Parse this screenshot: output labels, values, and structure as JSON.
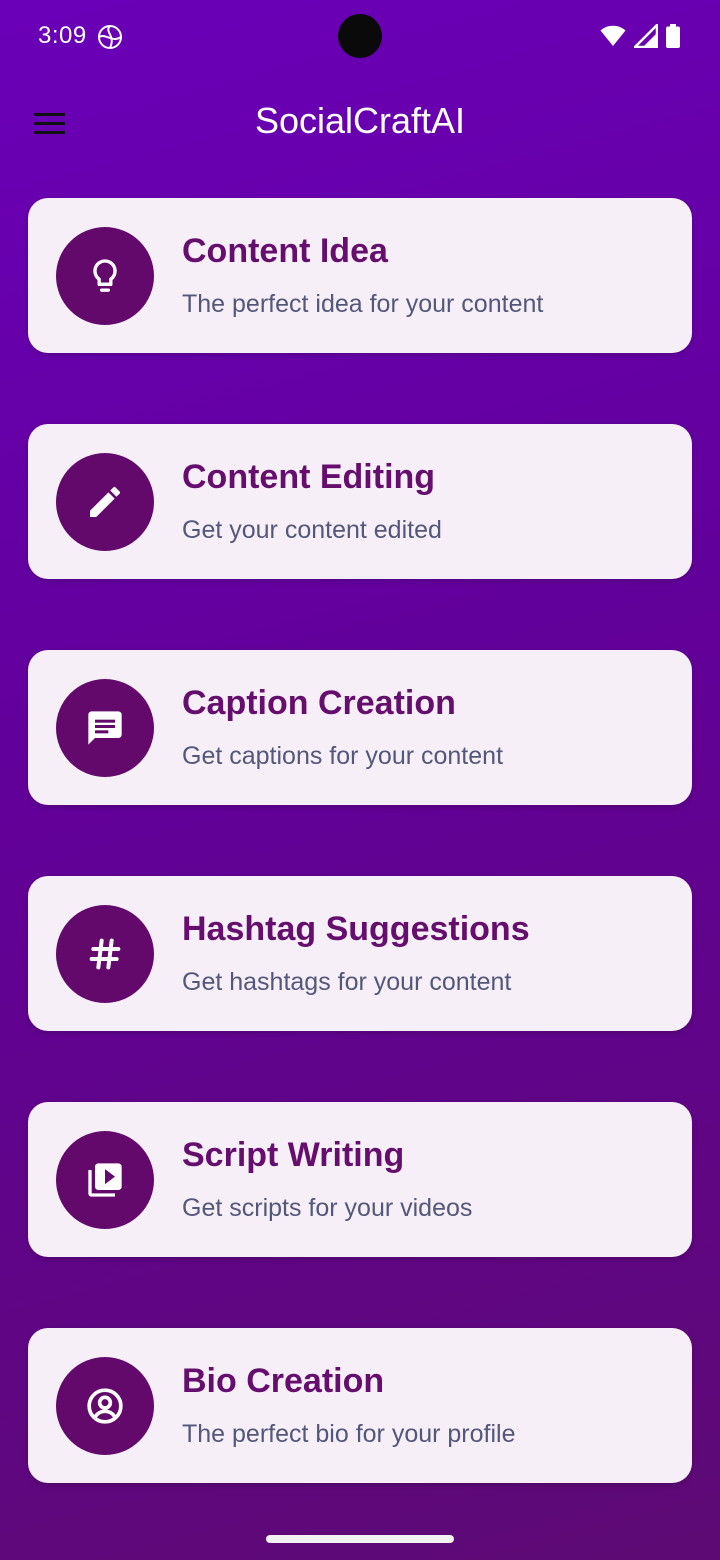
{
  "status_bar": {
    "time": "3:09"
  },
  "app_bar": {
    "title": "SocialCraftAI"
  },
  "colors": {
    "background_top": "#6a00b8",
    "background_bottom": "#5e0a74",
    "card_background": "#f6eff8",
    "icon_circle": "#63096c",
    "title_text": "#650e6e",
    "subtitle_text": "#54577a"
  },
  "cards": [
    {
      "icon": "lightbulb-icon",
      "title": "Content Idea",
      "subtitle": "The perfect idea for your content"
    },
    {
      "icon": "pencil-icon",
      "title": "Content Editing",
      "subtitle": "Get your content edited"
    },
    {
      "icon": "message-icon",
      "title": "Caption Creation",
      "subtitle": "Get captions for your content"
    },
    {
      "icon": "hashtag-icon",
      "title": "Hashtag Suggestions",
      "subtitle": "Get hashtags for your content"
    },
    {
      "icon": "video-library-icon",
      "title": "Script Writing",
      "subtitle": "Get scripts for your videos"
    },
    {
      "icon": "account-circle-icon",
      "title": "Bio Creation",
      "subtitle": "The perfect bio for your profile"
    }
  ]
}
